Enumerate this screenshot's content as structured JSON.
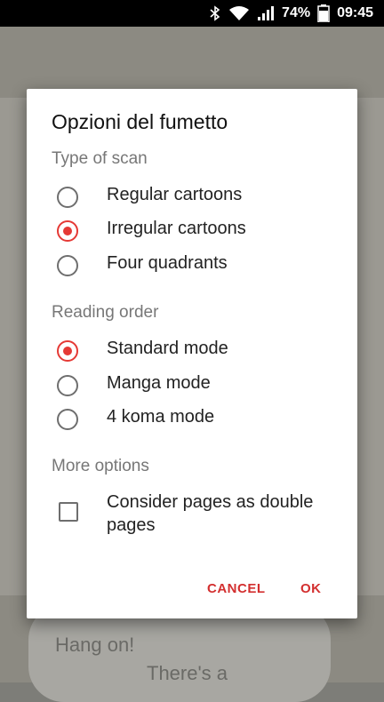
{
  "status_bar": {
    "battery_percent": "74%",
    "time": "09:45",
    "icons": [
      "bluetooth-icon",
      "wifi-icon",
      "signal-icon",
      "battery-icon"
    ]
  },
  "background": {
    "bubble_text_1": "Hang on!",
    "bubble_text_2": "There's a"
  },
  "dialog": {
    "title": "Opzioni del fumetto",
    "scan_section": {
      "title": "Type of scan",
      "options": [
        {
          "label": "Regular cartoons",
          "checked": false
        },
        {
          "label": "Irregular cartoons",
          "checked": true
        },
        {
          "label": "Four quadrants",
          "checked": false
        }
      ]
    },
    "reading_section": {
      "title": "Reading order",
      "options": [
        {
          "label": "Standard mode",
          "checked": true
        },
        {
          "label": "Manga mode",
          "checked": false
        },
        {
          "label": "4 koma mode",
          "checked": false
        }
      ]
    },
    "more_section": {
      "title": "More options",
      "checkbox_label": "Consider pages as double pages",
      "checkbox_checked": false
    },
    "buttons": {
      "cancel": "CANCEL",
      "ok": "OK"
    }
  },
  "colors": {
    "accent": "#e53935",
    "button_text": "#d32f2f"
  }
}
